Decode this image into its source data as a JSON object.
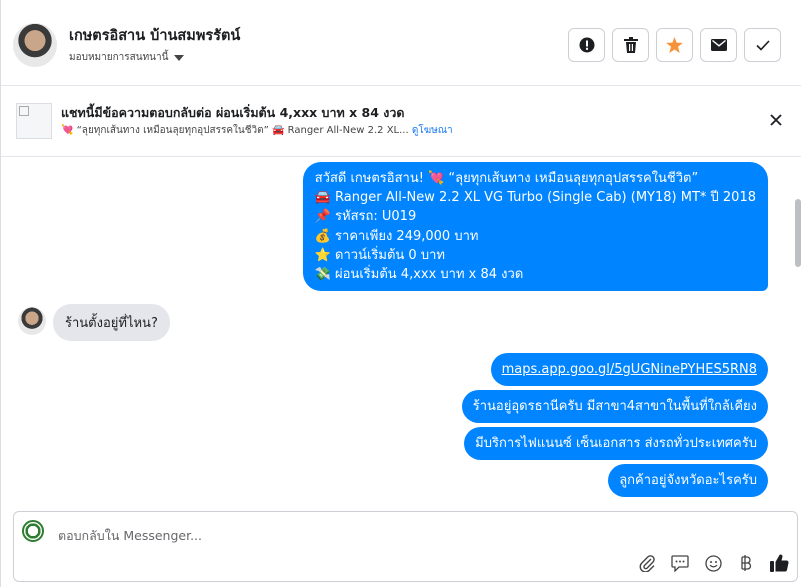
{
  "header": {
    "name": "เกษตรอิสาน บ้านสมพรรัตน์",
    "assign_label": "มอบหมายการสนทนานี้"
  },
  "actions": [
    {
      "icon": "alert-icon",
      "label": "spam"
    },
    {
      "icon": "trash-icon",
      "label": "delete"
    },
    {
      "icon": "star-icon",
      "label": "star",
      "color": "#f7923a"
    },
    {
      "icon": "mail-icon",
      "label": "mark unread"
    },
    {
      "icon": "check-icon",
      "label": "done"
    }
  ],
  "ad": {
    "title": "แชทนี้มีข้อความตอบกลับต่อ ผ่อนเริ่มต้น 4,xxx บาท x 84 งวด",
    "subtitle": "💘 “ลุยทุกเส้นทาง เหมือนลุยทุกอุปสรรคในชีวิต” 🚘 Ranger All-New 2.2 XL...",
    "link": "ดูโฆษณา"
  },
  "messages": {
    "m1": [
      "สวัสดี เกษตรอิสาน! 💘 “ลุยทุกเส้นทาง เหมือนลุยทุกอุปสรรคในชีวิต”",
      "🚘 Ranger All-New 2.2 XL VG Turbo (Single Cab) (MY18) MT* ปี 2018",
      "📌 รหัสรถ: U019",
      "💰 ราคาเพียง 249,000 บาท",
      "⭐ ดาวน์เริ่มต้น 0 บาท",
      "💸 ผ่อนเริ่มต้น 4,xxx บาท x 84 งวด"
    ],
    "m2": "ร้านตั้งอยู่ที่ไหน?",
    "m3": "maps.app.goo.gl/5gUGNinePYHES5RN8",
    "m4": "ร้านอยู่อุดรธานีครับ มีสาขา4สาขาในพื้นที่ใกล้เคียง",
    "m5": "มีบริการไฟแนนซ์ เซ็นเอกสาร ส่งรถทั่วประเทศครับ",
    "m6": "ลูกค้าอยู่จังหวัดอะไรครับ"
  },
  "composer": {
    "placeholder": "ตอบกลับใน Messenger..."
  },
  "colors": {
    "outgoing": "#0084ff",
    "incoming": "#e4e6eb"
  }
}
